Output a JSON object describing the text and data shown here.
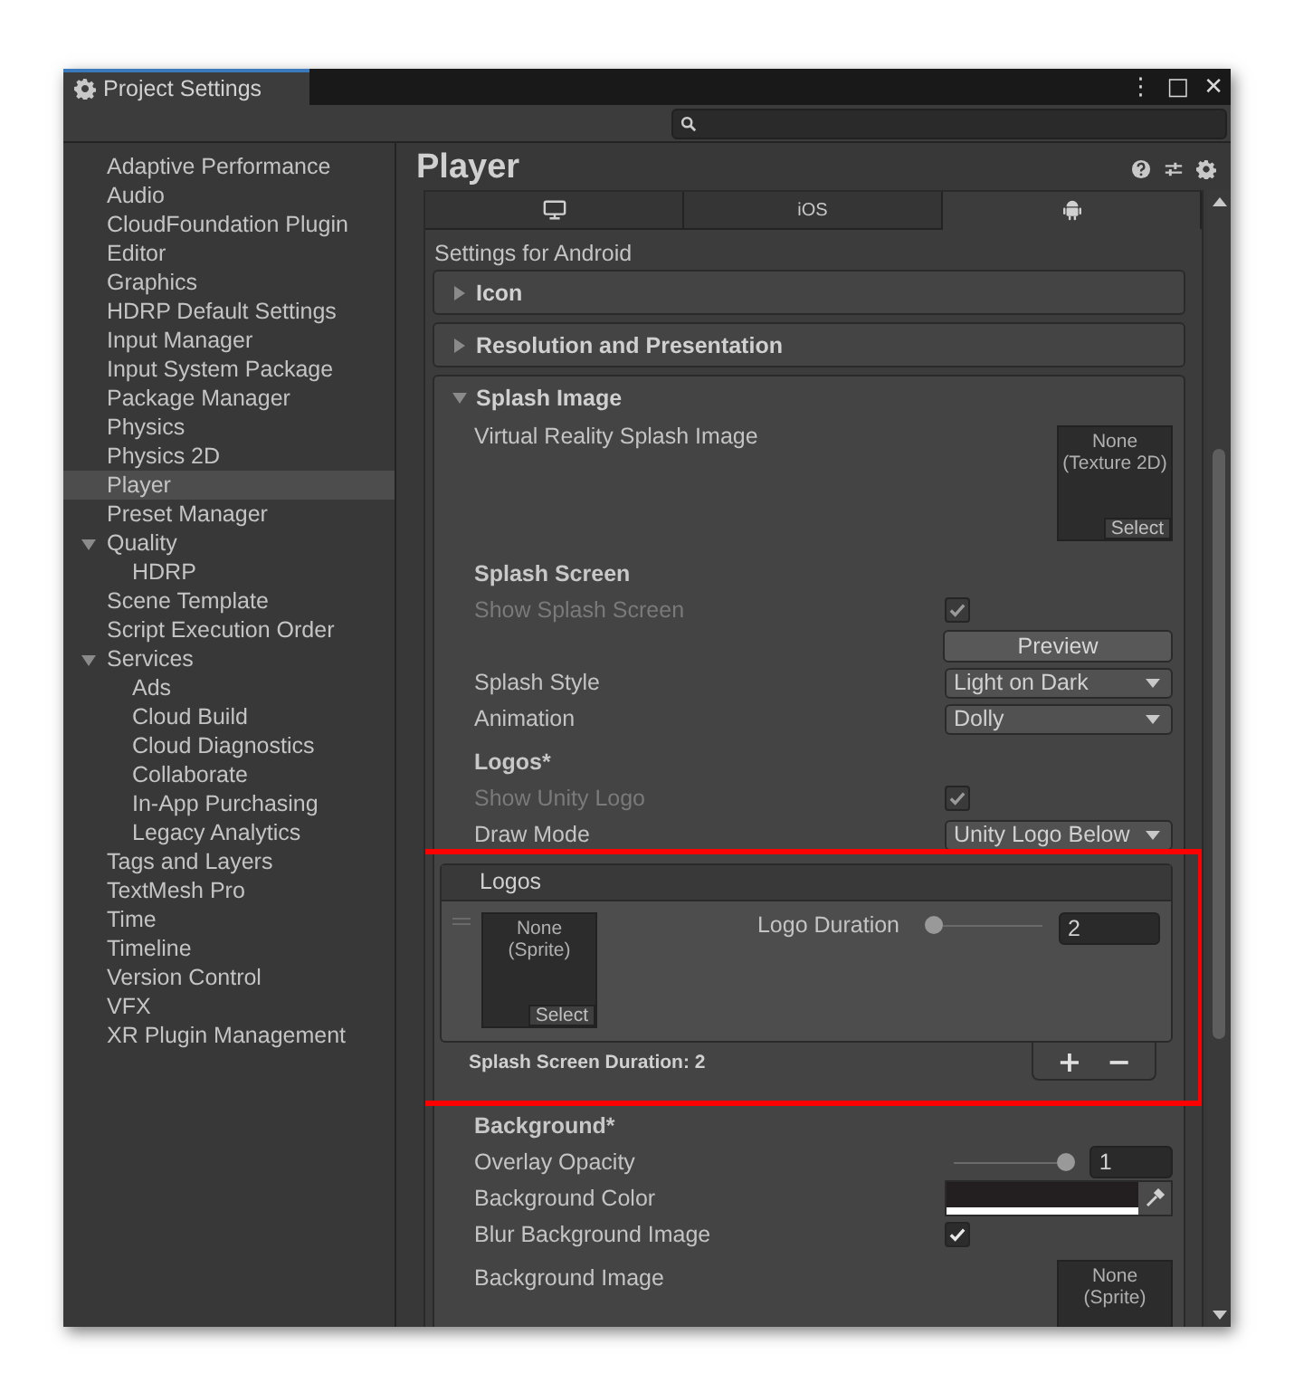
{
  "window": {
    "title": "Project Settings",
    "more": "⋮",
    "maximize": "□",
    "close": "✕"
  },
  "sidebar": {
    "items": [
      {
        "label": "Adaptive Performance",
        "selected": false
      },
      {
        "label": "Audio",
        "selected": false
      },
      {
        "label": "CloudFoundation Plugin",
        "selected": false
      },
      {
        "label": "Editor",
        "selected": false
      },
      {
        "label": "Graphics",
        "selected": false
      },
      {
        "label": "HDRP Default Settings",
        "selected": false
      },
      {
        "label": "Input Manager",
        "selected": false
      },
      {
        "label": "Input System Package",
        "selected": false
      },
      {
        "label": "Package Manager",
        "selected": false
      },
      {
        "label": "Physics",
        "selected": false
      },
      {
        "label": "Physics 2D",
        "selected": false
      },
      {
        "label": "Player",
        "selected": true
      },
      {
        "label": "Preset Manager",
        "selected": false
      },
      {
        "label": "Quality",
        "selected": false,
        "expanded": true,
        "children": [
          {
            "label": "HDRP",
            "selected": false
          }
        ]
      },
      {
        "label": "Scene Template",
        "selected": false
      },
      {
        "label": "Script Execution Order",
        "selected": false
      },
      {
        "label": "Services",
        "selected": false,
        "expanded": true,
        "children": [
          {
            "label": "Ads",
            "selected": false
          },
          {
            "label": "Cloud Build",
            "selected": false
          },
          {
            "label": "Cloud Diagnostics",
            "selected": false
          },
          {
            "label": "Collaborate",
            "selected": false
          },
          {
            "label": "In-App Purchasing",
            "selected": false
          },
          {
            "label": "Legacy Analytics",
            "selected": false
          }
        ]
      },
      {
        "label": "Tags and Layers",
        "selected": false
      },
      {
        "label": "TextMesh Pro",
        "selected": false
      },
      {
        "label": "Time",
        "selected": false
      },
      {
        "label": "Timeline",
        "selected": false
      },
      {
        "label": "Version Control",
        "selected": false
      },
      {
        "label": "VFX",
        "selected": false
      },
      {
        "label": "XR Plugin Management",
        "selected": false
      }
    ]
  },
  "page": {
    "title": "Player"
  },
  "platform_tabs": [
    {
      "kind": "desktop",
      "selected": false
    },
    {
      "kind": "text",
      "label": "iOS",
      "selected": false
    },
    {
      "kind": "android",
      "selected": true
    }
  ],
  "settings_title": "Settings for Android",
  "sections": [
    {
      "title": "Icon",
      "expanded": false
    },
    {
      "title": "Resolution and Presentation",
      "expanded": false
    },
    {
      "title": "Splash Image",
      "expanded": true
    }
  ],
  "splash": {
    "vr_image": {
      "label": "Virtual Reality Splash Image",
      "value": "None (Texture 2D)",
      "select": "Select"
    },
    "rows": [
      {
        "kind": "heading",
        "label": "Splash Screen"
      },
      {
        "kind": "checkbox",
        "label": "Show Splash Screen",
        "checked": true,
        "disabled": true
      },
      {
        "kind": "button",
        "label": "Preview"
      },
      {
        "kind": "dropdown",
        "label": "Splash Style",
        "value": "Light on Dark"
      },
      {
        "kind": "dropdown",
        "label": "Animation",
        "value": "Dolly"
      },
      {
        "kind": "heading",
        "label": "Logos*"
      },
      {
        "kind": "checkbox",
        "label": "Show Unity Logo",
        "checked": true,
        "disabled": true
      },
      {
        "kind": "dropdown",
        "label": "Draw Mode",
        "value": "Unity Logo Below"
      }
    ],
    "logos": {
      "header": "Logos",
      "items": [
        {
          "value": "None (Sprite)",
          "select": "Select",
          "label": "Logo Duration",
          "level": 0,
          "reading": "2"
        }
      ],
      "footer": "Splash Screen Duration: 2",
      "add": "+",
      "remove": "−"
    },
    "background_rows": [
      {
        "kind": "heading",
        "label": "Background*"
      },
      {
        "kind": "slider",
        "label": "Overlay Opacity",
        "level": 1,
        "reading": "1"
      },
      {
        "kind": "color",
        "label": "Background Color",
        "color": "#231f20"
      },
      {
        "kind": "checkbox",
        "label": "Blur Background Image",
        "checked": true,
        "disabled": false
      },
      {
        "kind": "object",
        "label": "Background Image",
        "value": "None (Sprite)"
      }
    ]
  }
}
